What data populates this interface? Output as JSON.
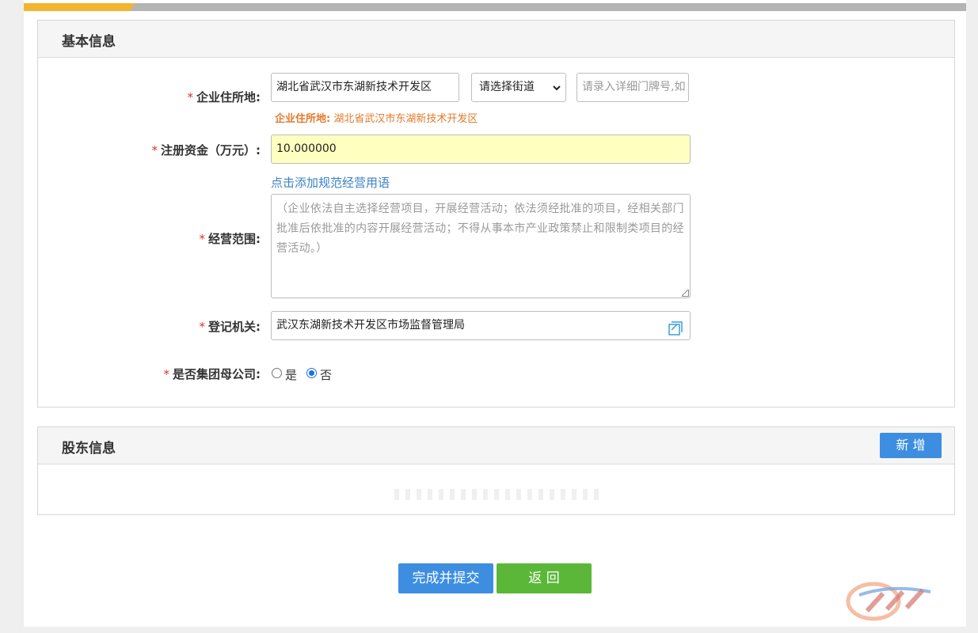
{
  "basic_info": {
    "title": "基本信息",
    "address": {
      "label": "企业住所地:",
      "district_value": "湖北省武汉市东湖新技术开发区",
      "street_select": "请选择街道",
      "detail_placeholder": "请录入详细门牌号,如",
      "hint_prefix": "企业住所地:",
      "hint_value": "湖北省武汉市东湖新技术开发区"
    },
    "capital": {
      "label": "注册资金（万元）:",
      "value": "10.000000"
    },
    "scope": {
      "add_link": "点击添加规范经营用语",
      "label": "经营范围:",
      "placeholder": "（企业依法自主选择经营项目，开展经营活动；依法须经批准的项目，经相关部门批准后依批准的内容开展经营活动；不得从事本市产业政策禁止和限制类项目的经营活动。）"
    },
    "authority": {
      "label": "登记机关:",
      "value": "武汉东湖新技术开发区市场监督管理局",
      "icon": "select-dialog-icon"
    },
    "group_parent": {
      "label": "是否集团母公司:",
      "option_yes": "是",
      "option_no": "否",
      "selected": "否"
    }
  },
  "shareholder_info": {
    "title": "股东信息",
    "add_button": "新 增"
  },
  "actions": {
    "submit": "完成并提交",
    "back": "返 回"
  },
  "colors": {
    "accent_yellow": "#f2b531",
    "input_highlight": "#ffffc0",
    "primary_blue": "#3d8ee0",
    "back_green": "#5bb738",
    "required_red": "#e0322b",
    "hint_orange": "#e27a2c",
    "link_blue": "#3b82c4"
  }
}
